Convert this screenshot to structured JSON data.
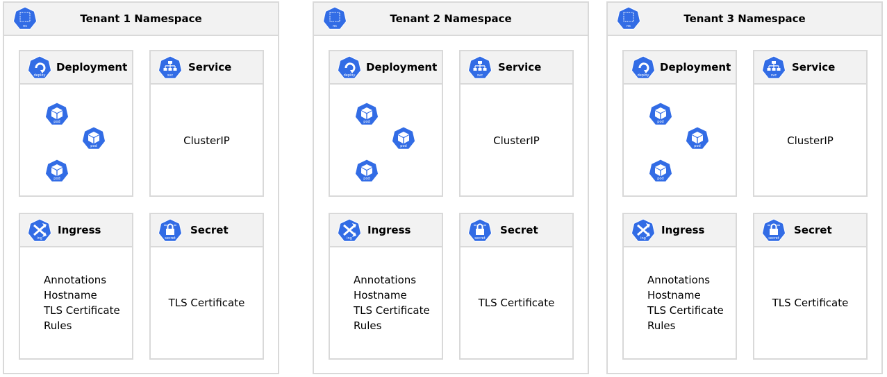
{
  "colors": {
    "k8s_blue": "#326ce5",
    "header_bg": "#f2f2f2",
    "border": "#d9d9d9"
  },
  "tenants": [
    {
      "title": "Tenant 1 Namespace"
    },
    {
      "title": "Tenant 2 Namespace"
    },
    {
      "title": "Tenant 3 Namespace"
    }
  ],
  "resources": {
    "deployment": {
      "title": "Deployment",
      "icon": "deploy",
      "pod_icon_label": "pod",
      "pod_count": 3
    },
    "service": {
      "title": "Service",
      "icon": "svc",
      "body": "ClusterIP"
    },
    "ingress": {
      "title": "Ingress",
      "icon": "ing",
      "body_lines": [
        "Annotations",
        "Hostname",
        "TLS Certificate",
        "Rules"
      ]
    },
    "secret": {
      "title": "Secret",
      "icon": "secret",
      "body": "TLS Certificate"
    }
  },
  "namespace_icon_label": "ns"
}
